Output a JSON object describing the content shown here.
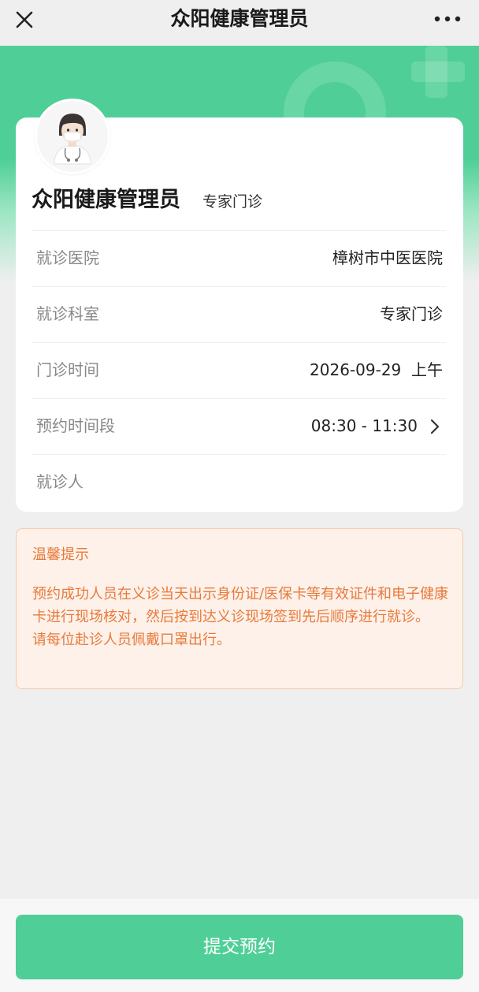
{
  "nav": {
    "title": "众阳健康管理员",
    "close_icon": "close-icon",
    "more_icon": "more-icon"
  },
  "doctor": {
    "name": "众阳健康管理员",
    "type": "专家门诊",
    "avatar_icon": "doctor-avatar-icon"
  },
  "rows": [
    {
      "label": "就诊医院",
      "value": "樟树市中医医院"
    },
    {
      "label": "就诊科室",
      "value": "专家门诊"
    },
    {
      "label": "门诊时间",
      "value": "2026-09-29  上午"
    },
    {
      "label": "预约时间段",
      "value": "08:30 - 11:30"
    },
    {
      "label": "就诊人",
      "value": ""
    }
  ],
  "notice": {
    "title": "温馨提示",
    "line1": "预约成功人员在义诊当天出示身份证/医保卡等有效证件和电子健康卡进行现场核对，然后按到达义诊现场签到先后顺序进行就诊。",
    "line2": "请每位赴诊人员佩戴口罩出行。"
  },
  "submit_label": "提交预约",
  "colors": {
    "brand_green": "#4fcf97",
    "notice_orange": "#e87a3a",
    "notice_bg": "#fdf1ea"
  }
}
